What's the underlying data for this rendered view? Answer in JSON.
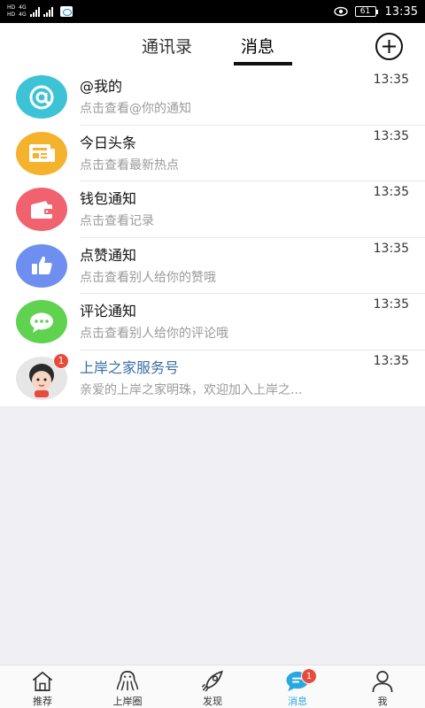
{
  "status_bar": {
    "sim1_label": "HD",
    "sim1_net": "4G",
    "sim2_label": "HD",
    "sim2_net": "4G",
    "battery": "61",
    "time": "13:35"
  },
  "header": {
    "tab_contacts": "通讯录",
    "tab_messages": "消息",
    "active_tab": "消息"
  },
  "messages": [
    {
      "title": "@我的",
      "subtitle": "点击查看@你的通知",
      "time": "13:35",
      "icon": "at-icon",
      "color": "#3ec3d6"
    },
    {
      "title": "今日头条",
      "subtitle": "点击查看最新热点",
      "time": "13:35",
      "icon": "newspaper-icon",
      "color": "#f5b22d"
    },
    {
      "title": "钱包通知",
      "subtitle": "点击查看记录",
      "time": "13:35",
      "icon": "wallet-icon",
      "color": "#f0626e"
    },
    {
      "title": "点赞通知",
      "subtitle": "点击查看别人给你的赞哦",
      "time": "13:35",
      "icon": "thumbs-up-icon",
      "color": "#6f8ff0"
    },
    {
      "title": "评论通知",
      "subtitle": "点击查看别人给你的评论哦",
      "time": "13:35",
      "icon": "comment-icon",
      "color": "#5fd24f"
    },
    {
      "title": "上岸之家服务号",
      "subtitle": "亲爱的上岸之家明珠，欢迎加入上岸之...",
      "time": "13:35",
      "icon": "service-avatar",
      "badge": "1"
    }
  ],
  "bottom_nav": [
    {
      "label": "推荐",
      "icon": "home-icon"
    },
    {
      "label": "上岸圈",
      "icon": "octopus-icon"
    },
    {
      "label": "发现",
      "icon": "rocket-icon"
    },
    {
      "label": "消息",
      "icon": "message-icon",
      "active": true,
      "badge": "1"
    },
    {
      "label": "我",
      "icon": "person-icon"
    }
  ],
  "colors": {
    "accent": "#29a8e0",
    "badge": "#e84a3b"
  }
}
